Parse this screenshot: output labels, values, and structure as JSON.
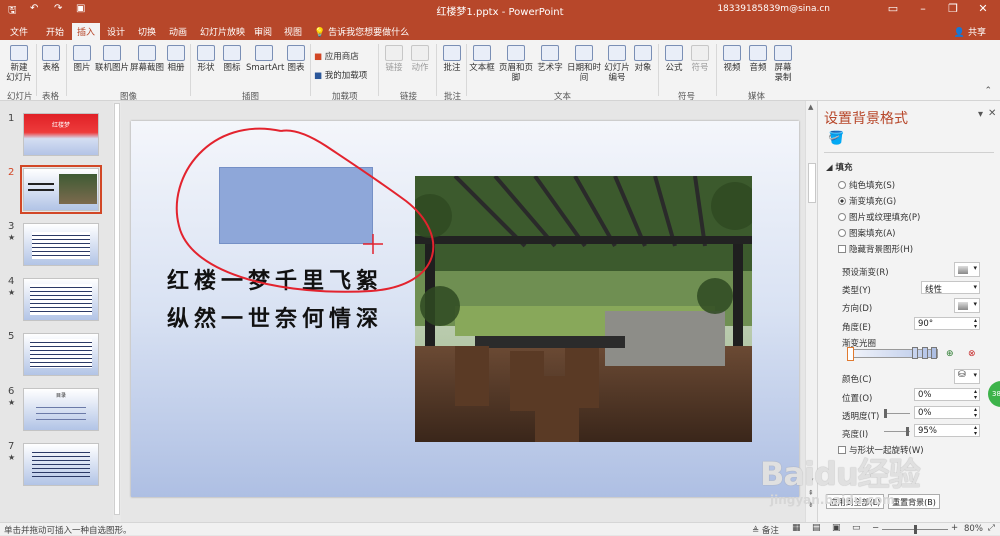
{
  "app": {
    "title": "红楼梦1.pptx - PowerPoint",
    "user": "18339185839m@sina.cn"
  },
  "tabs": [
    "文件",
    "开始",
    "插入",
    "设计",
    "切换",
    "动画",
    "幻灯片放映",
    "审阅",
    "视图"
  ],
  "tell_me": "告诉我您想要做什么",
  "share": "共享",
  "ribbon": {
    "buttons": [
      "新建\n幻灯片",
      "表格",
      "图片",
      "联机图片",
      "屏幕截图",
      "相册",
      "形状",
      "图标",
      "SmartArt",
      "图表",
      "链接",
      "动作",
      "批注",
      "文本框",
      "页眉和页脚",
      "艺术字",
      "日期和时间",
      "幻灯片\n编号",
      "对象",
      "公式",
      "符号",
      "视频",
      "音频",
      "屏幕\n录制"
    ],
    "small": [
      "应用商店",
      "我的加载项"
    ],
    "groups": [
      "幻灯片",
      "表格",
      "图像",
      "插图",
      "加载项",
      "链接",
      "批注",
      "文本",
      "符号",
      "媒体"
    ]
  },
  "thumbnails": {
    "numbers": [
      "1",
      "2",
      "3",
      "4",
      "5",
      "6",
      "7"
    ],
    "slide1_title": "红楼梦",
    "slide6_title": "目录"
  },
  "slide": {
    "line1": "红楼一梦千里飞絮",
    "line2": "纵然一世奈何情深"
  },
  "pane": {
    "title": "设置背景格式",
    "section": "填充",
    "options": [
      "纯色填充(S)",
      "渐变填充(G)",
      "图片或纹理填充(P)",
      "图案填充(A)",
      "隐藏背景图形(H)"
    ],
    "labels": [
      "预设渐变(R)",
      "类型(Y)",
      "方向(D)",
      "角度(E)",
      "渐变光圈",
      "颜色(C)",
      "位置(O)",
      "透明度(T)",
      "亮度(I)"
    ],
    "type_value": "线性",
    "angle_value": "90°",
    "position_value": "0%",
    "transparency_value": "0%",
    "brightness_value": "95%",
    "rotate_label": "与形状一起旋转(W)",
    "btn_apply_all": "应用到全部(L)",
    "btn_reset": "重置背景(B)",
    "badge": "38"
  },
  "status": {
    "left": "单击并拖动可插入一种自选图形。",
    "notes": "备注",
    "zoom": "80%"
  },
  "watermark": {
    "brand": "Baidu经验",
    "url": "jingyan.baidu.com"
  },
  "colors": {
    "accent": "#b7472a",
    "selection": "#d24726"
  }
}
